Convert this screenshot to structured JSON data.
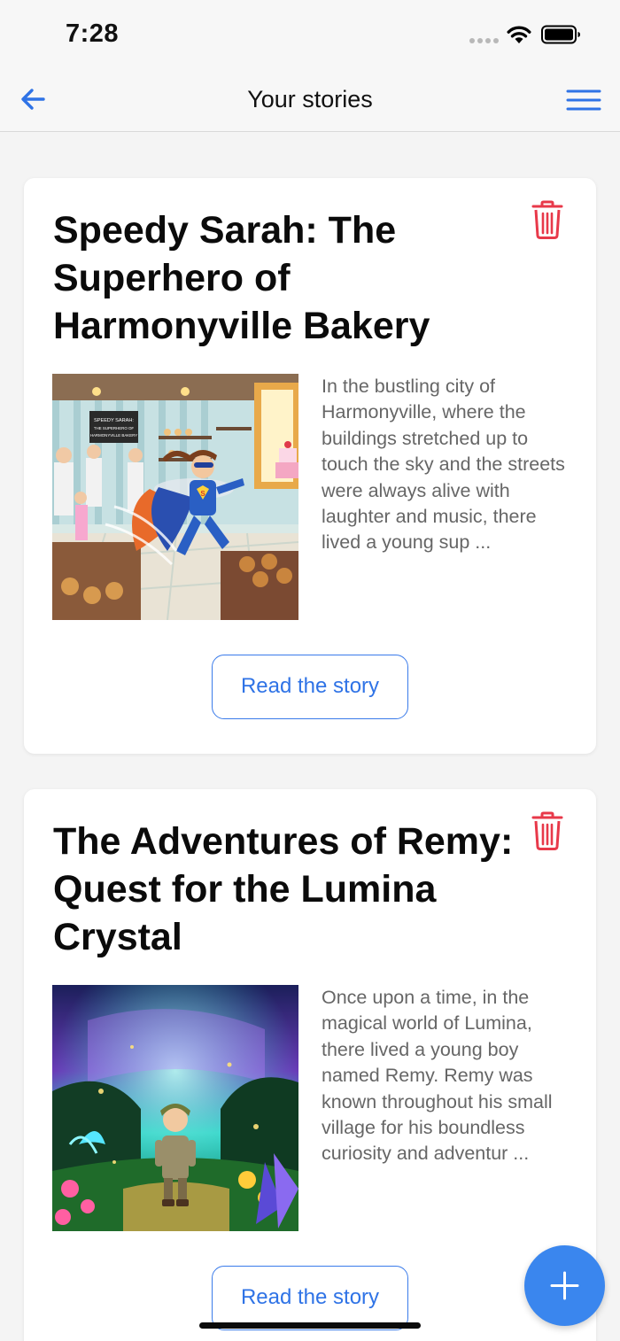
{
  "status": {
    "time": "7:28"
  },
  "nav": {
    "title": "Your stories",
    "back_icon": "arrow-left-icon",
    "menu_icon": "hamburger-menu-icon"
  },
  "colors": {
    "accent": "#2f73e6",
    "delete": "#e8394a",
    "fab": "#3a86ee"
  },
  "stories": [
    {
      "title": "Speedy Sarah: The Superhero of Harmonyville Bakery",
      "excerpt": "In the bustling city of Harmonyville, where the buildings stretched up to touch the sky and the streets were always alive with laughter and music, there lived a young sup ...",
      "button_label": "Read the story",
      "image_sign": [
        "SPEEDY SARAH:",
        "THE SUPERHERO OF",
        "HARMONYVILLE BAKERY"
      ]
    },
    {
      "title": "The Adventures of Remy: Quest for the Lumina Crystal",
      "excerpt": "Once upon a time, in the magical world of Lumina, there lived a young boy named Remy. Remy was known throughout his small village for his boundless curiosity and adventur ...",
      "button_label": "Read the story"
    }
  ],
  "fab": {
    "icon": "plus-icon"
  }
}
